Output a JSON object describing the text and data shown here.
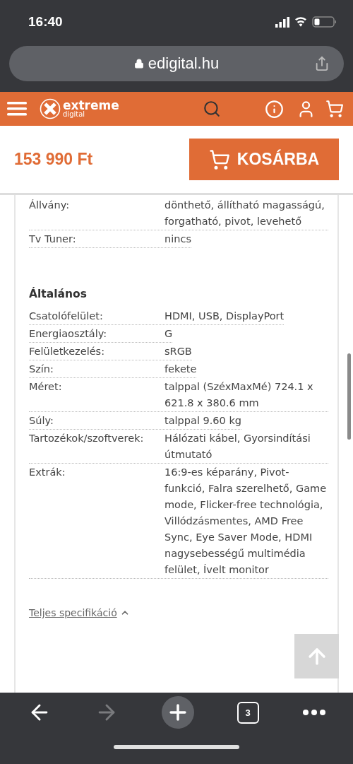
{
  "status_bar": {
    "time": "16:40"
  },
  "address_bar": {
    "url": "edigital.hu"
  },
  "header": {
    "logo_main": "extreme",
    "logo_sub": "digital"
  },
  "buy_bar": {
    "price": "153 990 Ft",
    "button": "KOSÁRBA"
  },
  "spec_groups": [
    {
      "rows": [
        {
          "label": "Állvány:",
          "value": "dönthető, állítható magasságú, forgatható, pivot, levehető"
        },
        {
          "label": "Tv Tuner:",
          "value": "nincs"
        }
      ]
    },
    {
      "title": "Általános",
      "rows": [
        {
          "label": "Csatolófelület:",
          "value": "HDMI, USB, DisplayPort"
        },
        {
          "label": "Energiaosztály:",
          "value": "G"
        },
        {
          "label": "Felületkezelés:",
          "value": "sRGB"
        },
        {
          "label": "Szín:",
          "value": "fekete"
        },
        {
          "label": "Méret:",
          "value": "talppal (SzéxMaxMé) 724.1 x 621.8 x 380.6 mm"
        },
        {
          "label": "Súly:",
          "value": "talppal 9.60 kg"
        },
        {
          "label": "Tartozékok/szoftverek:",
          "value": "Hálózati kábel, Gyorsindítási útmutató"
        },
        {
          "label": "Extrák:",
          "value": "16:9-es képarány, Pivot-funkció, Falra szerelhető, Game mode, Flicker-free technológia, Villódzásmentes, AMD Free Sync, Eye Saver Mode, HDMI nagysebességű multimédia felület, Ívelt monitor"
        }
      ]
    }
  ],
  "full_spec_link": {
    "label": "Teljes specifikáció",
    "expanded": true
  },
  "toolbar": {
    "forward_disabled": true,
    "tab_count": "3"
  }
}
